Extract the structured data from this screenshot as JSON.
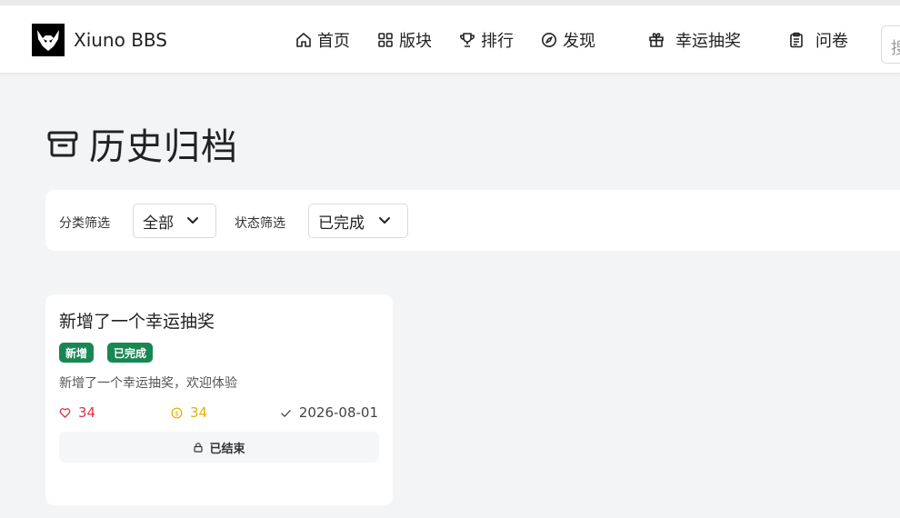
{
  "brand": {
    "name": "Xiuno BBS",
    "logo_icon": "bull-head-logo"
  },
  "nav": {
    "home": "首页",
    "boards": "版块",
    "rank": "排行",
    "discover": "发现",
    "lottery": "幸运抽奖",
    "survey": "问卷"
  },
  "search": {
    "placeholder": "搜"
  },
  "page": {
    "title": "历史归档",
    "title_icon": "archive-icon"
  },
  "filters": {
    "category_label": "分类筛选",
    "category_value": "全部",
    "status_label": "状态筛选",
    "status_value": "已完成"
  },
  "cards": [
    {
      "title": "新增了一个幸运抽奖",
      "tags": [
        "新增",
        "已完成"
      ],
      "description": "新增了一个幸运抽奖，欢迎体验",
      "likes": "34",
      "coins": "34",
      "date": "2026-08-01",
      "status_button": "已结束"
    }
  ],
  "colors": {
    "tag_bg": "#198754",
    "likes": "#dc3545",
    "coins": "#e5b000",
    "page_bg": "#f3f4f6"
  }
}
